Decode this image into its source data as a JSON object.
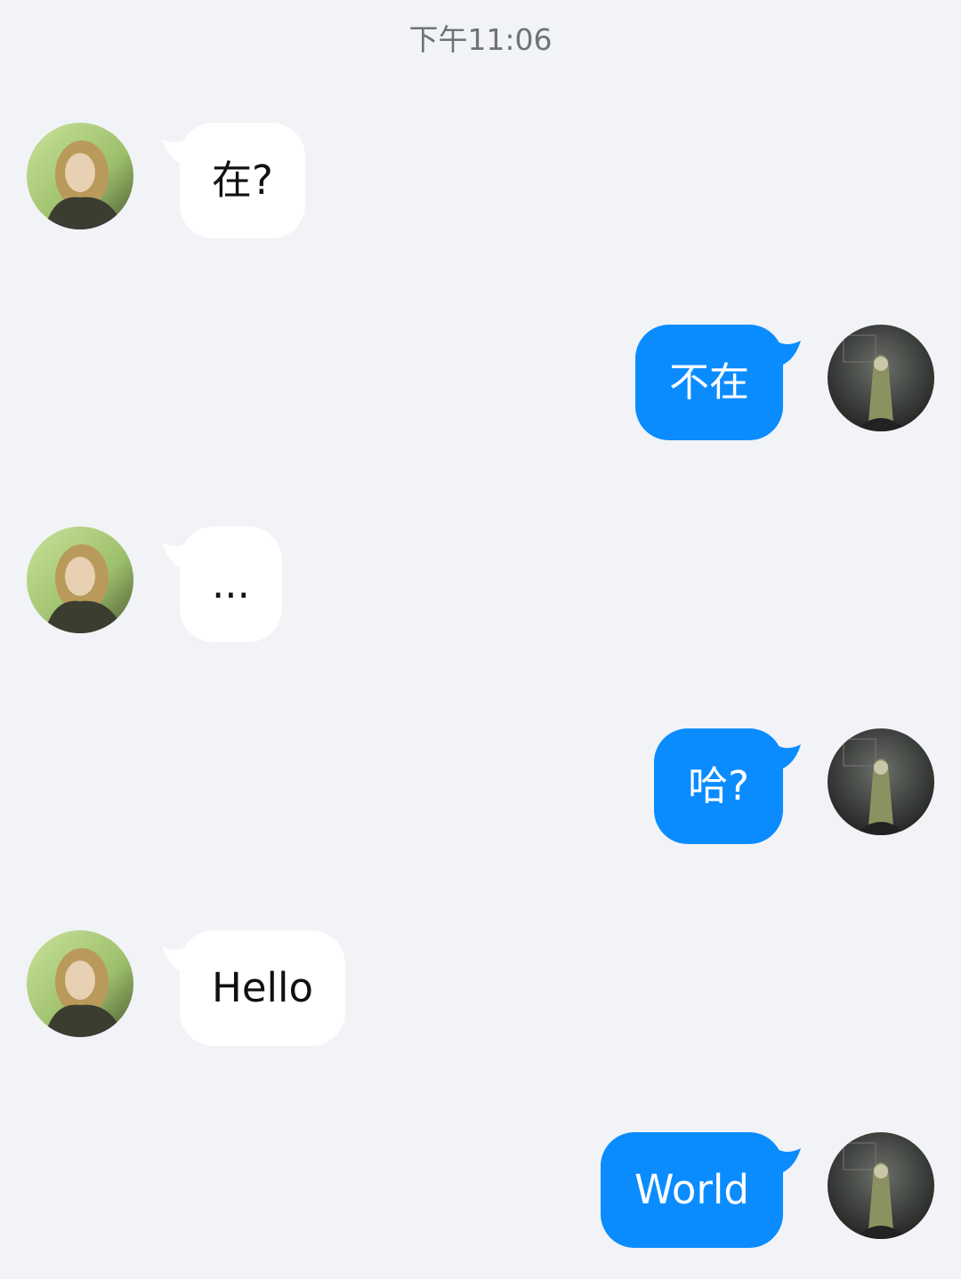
{
  "header": {
    "timestamp": "下午11:06"
  },
  "messages": [
    {
      "side": "left",
      "text": "在?",
      "avatar": "girl-avatar"
    },
    {
      "side": "right",
      "text": "不在",
      "avatar": "dark-figure-avatar"
    },
    {
      "side": "left",
      "text": "...",
      "avatar": "girl-avatar"
    },
    {
      "side": "right",
      "text": "哈?",
      "avatar": "dark-figure-avatar"
    },
    {
      "side": "left",
      "text": "Hello",
      "avatar": "girl-avatar"
    },
    {
      "side": "right",
      "text": "World",
      "avatar": "dark-figure-avatar"
    }
  ],
  "colors": {
    "background": "#f1f3f6",
    "incoming_bubble": "#ffffff",
    "outgoing_bubble": "#0a8cff",
    "timestamp_text": "#6f7277"
  }
}
